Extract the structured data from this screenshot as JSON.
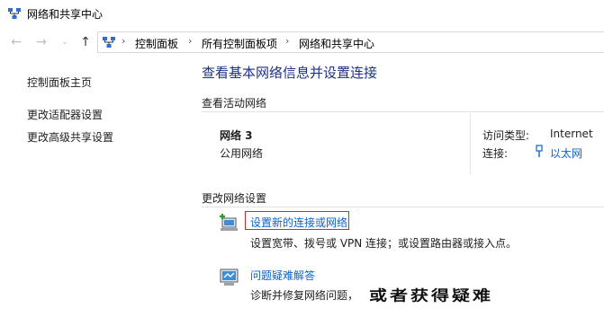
{
  "window": {
    "title": "网络和共享中心"
  },
  "address_bar": {
    "crumbs": [
      "控制面板",
      "所有控制面板项",
      "网络和共享中心"
    ]
  },
  "sidebar": {
    "items": [
      {
        "label": "控制面板主页"
      },
      {
        "label": "更改适配器设置"
      },
      {
        "label": "更改高级共享设置"
      }
    ]
  },
  "main": {
    "title": "查看基本网络信息并设置连接",
    "active_networks": {
      "header": "查看活动网络",
      "network_name": "网络  3",
      "network_type": "公用网络",
      "access_type_label": "访问类型:",
      "access_type_value": "Internet",
      "connection_label": "连接:",
      "connection_value": "以太网"
    },
    "change_settings": {
      "header": "更改网络设置",
      "tasks": [
        {
          "link": "设置新的连接或网络",
          "desc": "设置宽带、拨号或 VPN 连接；或设置路由器或接入点。",
          "icon": "new-connection-icon"
        },
        {
          "link": "问题疑难解答",
          "desc": "诊断并修复网络问题，",
          "icon": "troubleshoot-icon"
        }
      ]
    }
  },
  "overlay": {
    "watermark": "或者获得疑难"
  },
  "colors": {
    "link": "#0b64c8",
    "title": "#1e3287",
    "highlight_border": "#e02424"
  }
}
